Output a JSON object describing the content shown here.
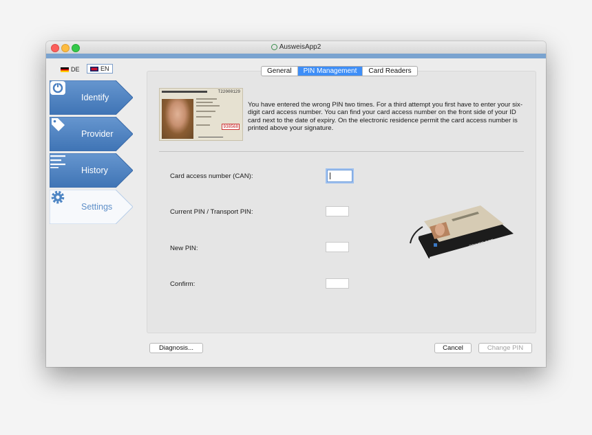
{
  "window": {
    "title": "AusweisApp2"
  },
  "language": {
    "de_label": "DE",
    "en_label": "EN",
    "selected": "EN"
  },
  "nav": [
    {
      "label": "Identify",
      "icon": "identify-icon",
      "active": true
    },
    {
      "label": "Provider",
      "icon": "tag-icon",
      "active": true
    },
    {
      "label": "History",
      "icon": "list-icon",
      "active": true
    },
    {
      "label": "Settings",
      "icon": "gear-icon",
      "active": false
    }
  ],
  "tabs": {
    "general": "General",
    "pin_management": "PIN Management",
    "card_readers": "Card Readers",
    "selected": "PIN Management"
  },
  "idcard": {
    "number": "T22000129",
    "can": "938568"
  },
  "info_text": "You have entered the wrong PIN two times. For a third attempt you first have to enter your six-digit card access number. You can find your card access number on the front side of your ID card next to the date of expiry. On the electronic residence permit the card access number is printed above your signature.",
  "form": {
    "can_label": "Card access number (CAN):",
    "current_pin_label": "Current PIN / Transport PIN:",
    "new_pin_label": "New PIN:",
    "confirm_label": "Confirm:"
  },
  "reader": {
    "brand": "REINER SCT"
  },
  "buttons": {
    "diagnosis": "Diagnosis...",
    "cancel": "Cancel",
    "change_pin": "Change PIN"
  },
  "colors": {
    "nav_blue": "#4f86c4",
    "accent": "#3e8ef7",
    "titlebar_blue": "#7aa3cf"
  }
}
